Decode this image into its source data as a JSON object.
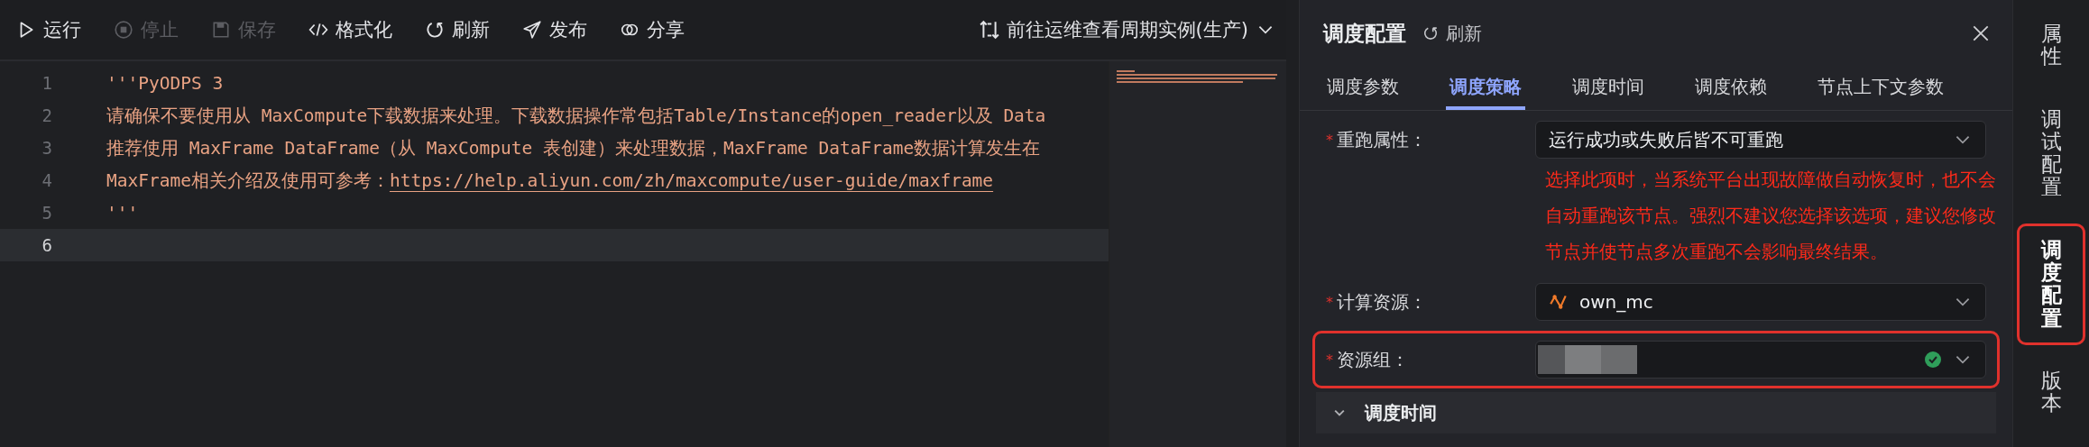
{
  "toolbar": {
    "actions": [
      {
        "label": "运行",
        "kind": "run",
        "disabled": false
      },
      {
        "label": "停止",
        "kind": "stop",
        "disabled": true
      },
      {
        "label": "保存",
        "kind": "save",
        "disabled": true
      },
      {
        "label": "格式化",
        "kind": "format",
        "disabled": false
      },
      {
        "label": "刷新",
        "kind": "refresh",
        "disabled": false
      },
      {
        "label": "发布",
        "kind": "publish",
        "disabled": false
      },
      {
        "label": "分享",
        "kind": "share",
        "disabled": false
      }
    ],
    "goto": {
      "label": "前往运维查看周期实例(生产)"
    }
  },
  "editor": {
    "lines": [
      {
        "number": "1",
        "text": "'''PyODPS 3",
        "current": false
      },
      {
        "number": "2",
        "text": "请确保不要使用从 MaxCompute下载数据来处理。下载数据操作常包括Table/Instance的open_reader以及 Data",
        "current": false
      },
      {
        "number": "3",
        "text": "推荐使用 MaxFrame DataFrame（从 MaxCompute 表创建）来处理数据，MaxFrame DataFrame数据计算发生在",
        "current": false
      },
      {
        "number": "4",
        "text": "MaxFrame相关介绍及使用可参考：",
        "link": "https://help.aliyun.com/zh/maxcompute/user-guide/maxframe",
        "current": false
      },
      {
        "number": "5",
        "text": "'''",
        "current": false
      },
      {
        "number": "6",
        "current": true
      }
    ]
  },
  "panel": {
    "title": "调度配置",
    "refresh": "刷新",
    "tabs": [
      {
        "label": "调度参数",
        "selected": false
      },
      {
        "label": "调度策略",
        "selected": true
      },
      {
        "label": "调度时间",
        "selected": false
      },
      {
        "label": "调度依赖",
        "selected": false
      },
      {
        "label": "节点上下文参数",
        "selected": false
      }
    ],
    "fields": [
      {
        "kind": "select",
        "required_mark": "*",
        "label": "重跑属性：",
        "value": "运行成功或失败后皆不可重跑",
        "warning": "选择此项时，当系统平台出现故障做自动恢复时，也不会自动重跑该节点。强烈不建议您选择该选项，建议您修改节点并使节点多次重跑不会影响最终结果。",
        "highlighted": false
      },
      {
        "kind": "resource",
        "required_mark": "*",
        "label": "计算资源：",
        "value": "own_mc",
        "highlighted": false
      },
      {
        "kind": "redacted",
        "required_mark": "*",
        "label": "资源组：",
        "valid": true,
        "highlighted": true
      }
    ],
    "section": {
      "title": "调度时间",
      "expanded": true
    }
  },
  "side_tabs": [
    {
      "label": "属性",
      "selected": false,
      "highlighted": false
    },
    {
      "label": "调试配置",
      "selected": false,
      "highlighted": false
    },
    {
      "label": "调度配置",
      "selected": true,
      "highlighted": true
    },
    {
      "label": "版本",
      "selected": false,
      "highlighted": false
    }
  ]
}
